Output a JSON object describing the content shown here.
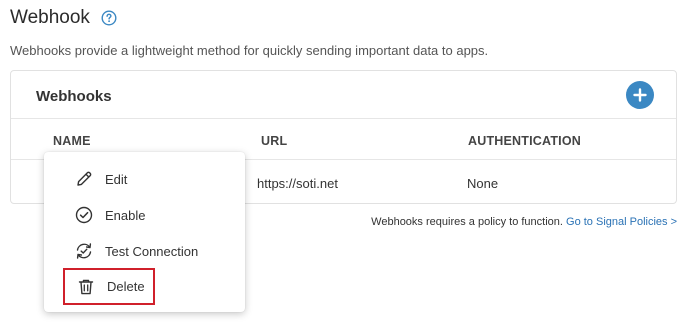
{
  "page": {
    "title": "Webhook",
    "description": "Webhooks provide a lightweight method for quickly sending important data to apps."
  },
  "card": {
    "title": "Webhooks",
    "columns": [
      "NAME",
      "URL",
      "AUTHENTICATION"
    ],
    "rows": [
      {
        "name": "",
        "url": "https://soti.net",
        "authentication": "None"
      }
    ]
  },
  "footnote": {
    "text": "Webhooks requires a policy to function.",
    "link": "Go to Signal Policies >"
  },
  "menu": {
    "items": [
      {
        "label": "Edit",
        "icon": "pencil-icon"
      },
      {
        "label": "Enable",
        "icon": "check-circle-icon"
      },
      {
        "label": "Test Connection",
        "icon": "sync-check-icon"
      },
      {
        "label": "Delete",
        "icon": "trash-icon",
        "highlighted": true
      }
    ]
  },
  "colors": {
    "accent": "#3b88c3",
    "link": "#2a72b5",
    "highlight": "#d0202b"
  }
}
